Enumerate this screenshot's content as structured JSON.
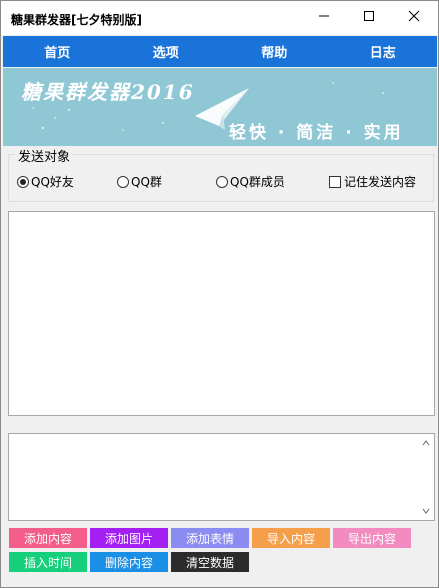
{
  "window": {
    "title": "糖果群发器[七夕特别版]"
  },
  "menu": {
    "items": [
      {
        "label": "首页"
      },
      {
        "label": "选项"
      },
      {
        "label": "帮助"
      },
      {
        "label": "日志"
      }
    ]
  },
  "banner": {
    "title": "糖果群发器2016",
    "slogan": "轻快 · 简洁 · 实用",
    "icon": "paper-plane-icon"
  },
  "send_target": {
    "legend": "发送对象",
    "options": [
      {
        "label": "QQ好友",
        "selected": true
      },
      {
        "label": "QQ群",
        "selected": false
      },
      {
        "label": "QQ群成员",
        "selected": false
      }
    ],
    "remember_label": "记住发送内容",
    "remember_checked": false
  },
  "buttons": {
    "row1": [
      {
        "label": "添加内容",
        "color": "#f25d8a"
      },
      {
        "label": "添加图片",
        "color": "#a41ff2"
      },
      {
        "label": "添加表情",
        "color": "#8a8cf2"
      },
      {
        "label": "导入内容",
        "color": "#f59f4a"
      },
      {
        "label": "导出内容",
        "color": "#f28bbf"
      }
    ],
    "row2": [
      {
        "label": "插入时间",
        "color": "#16cf7a"
      },
      {
        "label": "删除内容",
        "color": "#1a8fe6"
      },
      {
        "label": "清空数据",
        "color": "#2c2c2c"
      }
    ]
  },
  "colors": {
    "menubar": "#1a73d9",
    "banner": "#8fc7d4"
  }
}
